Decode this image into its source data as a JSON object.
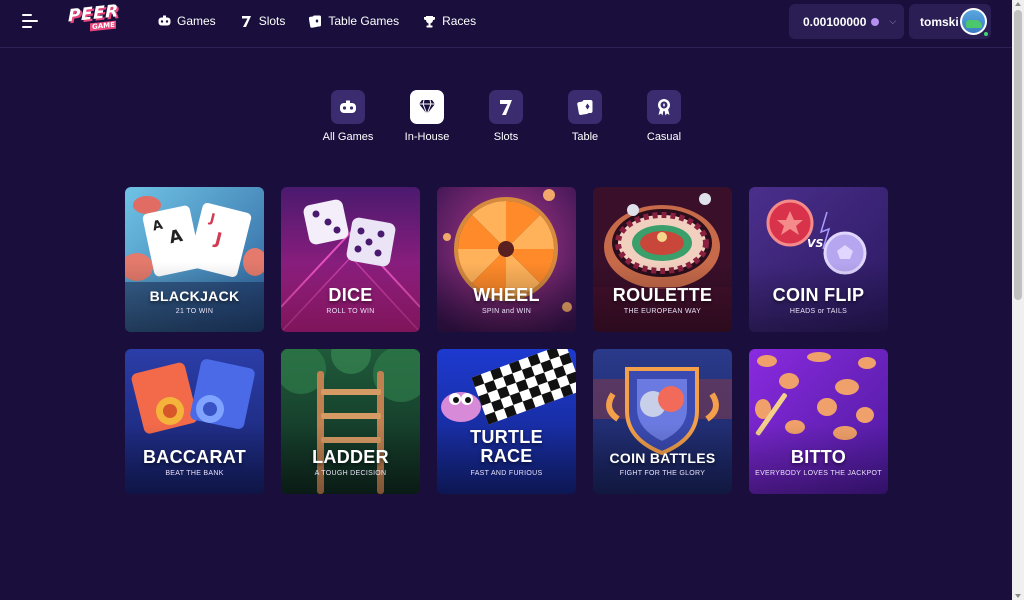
{
  "header": {
    "logo_top": "PEER",
    "logo_bottom": "GAME",
    "nav": [
      {
        "label": "Games",
        "icon": "gamepad-icon"
      },
      {
        "label": "Slots",
        "icon": "seven-icon"
      },
      {
        "label": "Table Games",
        "icon": "cards-icon"
      },
      {
        "label": "Races",
        "icon": "trophy-icon"
      }
    ],
    "wallet": {
      "amount": "0.00100000",
      "coin_color": "#b48ef0"
    },
    "user": {
      "name": "tomski"
    }
  },
  "categories": [
    {
      "label": "All Games",
      "icon": "gamepad-icon",
      "active": false
    },
    {
      "label": "In-House",
      "icon": "diamond-icon",
      "active": true
    },
    {
      "label": "Slots",
      "icon": "seven-icon",
      "active": false
    },
    {
      "label": "Table",
      "icon": "cards-icon",
      "active": false
    },
    {
      "label": "Casual",
      "icon": "badge-icon",
      "active": false
    }
  ],
  "games": [
    {
      "title": "BLACKJACK",
      "subtitle": "21 TO WIN"
    },
    {
      "title": "DICE",
      "subtitle": "ROLL TO WIN"
    },
    {
      "title": "WHEEL",
      "subtitle": "SPIN and WIN"
    },
    {
      "title": "ROULETTE",
      "subtitle": "THE EUROPEAN WAY"
    },
    {
      "title": "COIN FLIP",
      "subtitle": "HEADS or TAILS"
    },
    {
      "title": "BACCARAT",
      "subtitle": "BEAT THE BANK"
    },
    {
      "title": "LADDER",
      "subtitle": "A TOUGH DECISION"
    },
    {
      "title_line1": "TURTLE",
      "title_line2": "RACE",
      "subtitle": "FAST AND FURIOUS"
    },
    {
      "title": "COIN BATTLES",
      "subtitle": "FIGHT FOR THE GLORY"
    },
    {
      "title": "BITTO",
      "subtitle": "EVERYBODY LOVES THE JACKPOT"
    }
  ],
  "colors": {
    "background": "#1a0f3c",
    "accent": "#e8467c",
    "panel": "#2a1e55"
  }
}
